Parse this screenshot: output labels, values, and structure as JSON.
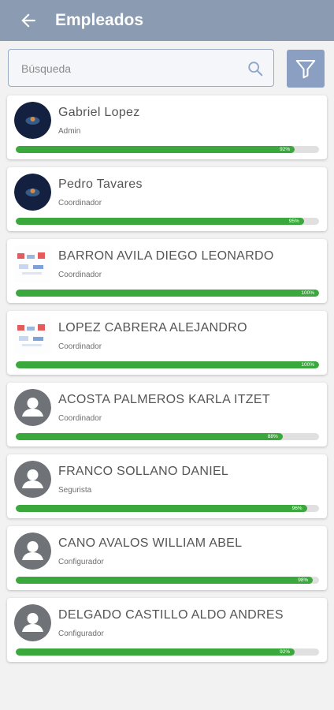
{
  "header": {
    "title": "Empleados",
    "back_icon": "arrow-left-icon"
  },
  "search": {
    "placeholder": "Búsqueda",
    "value": "",
    "search_icon": "search-icon",
    "filter_icon": "filter-icon"
  },
  "colors": {
    "appbar": "#8a9bb2",
    "progress": "#3aa83c",
    "filter_button": "#8a9fc2"
  },
  "employees": [
    {
      "name": "Gabriel Lopez",
      "role": "Admin",
      "progress": 92,
      "progress_label": "92%",
      "avatar": "photo-dark"
    },
    {
      "name": "Pedro Tavares",
      "role": "Coordinador",
      "progress": 95,
      "progress_label": "95%",
      "avatar": "photo-dark"
    },
    {
      "name": "BARRON AVILA DIEGO LEONARDO",
      "role": "Coordinador",
      "progress": 100,
      "progress_label": "100%",
      "avatar": "photo-light"
    },
    {
      "name": "LOPEZ CABRERA ALEJANDRO",
      "role": "Coordinador",
      "progress": 100,
      "progress_label": "100%",
      "avatar": "photo-light"
    },
    {
      "name": "ACOSTA PALMEROS KARLA ITZET",
      "role": "Coordinador",
      "progress": 88,
      "progress_label": "88%",
      "avatar": "default-user"
    },
    {
      "name": "FRANCO SOLLANO DANIEL",
      "role": "Segurista",
      "progress": 96,
      "progress_label": "96%",
      "avatar": "default-user"
    },
    {
      "name": "CANO AVALOS WILLIAM ABEL",
      "role": "Configurador",
      "progress": 98,
      "progress_label": "98%",
      "avatar": "default-user"
    },
    {
      "name": "DELGADO CASTILLO ALDO ANDRES",
      "role": "Configurador",
      "progress": 92,
      "progress_label": "92%",
      "avatar": "default-user"
    }
  ]
}
